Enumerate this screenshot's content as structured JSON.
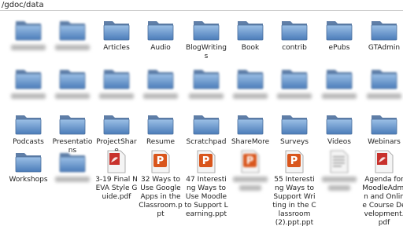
{
  "path": "/gdoc/data",
  "rows": [
    [
      {
        "label": "",
        "type": "folder",
        "blurred": true
      },
      {
        "label": "",
        "type": "folder",
        "blurred": true
      },
      {
        "label": "Articles",
        "type": "folder"
      },
      {
        "label": "Audio",
        "type": "folder"
      },
      {
        "label": "BlogWritings",
        "type": "folder"
      },
      {
        "label": "Book",
        "type": "folder"
      },
      {
        "label": "contrib",
        "type": "folder"
      },
      {
        "label": "ePubs",
        "type": "folder"
      },
      {
        "label": "GTAdmin",
        "type": "folder"
      }
    ],
    [
      {
        "label": "",
        "type": "folder",
        "blurred": true
      },
      {
        "label": "",
        "type": "folder",
        "blurred": true
      },
      {
        "label": "",
        "type": "folder",
        "blurred": true
      },
      {
        "label": "",
        "type": "folder",
        "blurred": true
      },
      {
        "label": "",
        "type": "folder",
        "blurred": true
      },
      {
        "label": "",
        "type": "folder",
        "blurred": true
      },
      {
        "label": "",
        "type": "folder",
        "blurred": true
      },
      {
        "label": "",
        "type": "folder",
        "blurred": true
      },
      {
        "label": "",
        "type": "folder",
        "blurred": true
      }
    ],
    [
      {
        "label": "Podcasts",
        "type": "folder"
      },
      {
        "label": "Presentations",
        "type": "folder"
      },
      {
        "label": "ProjectShare",
        "type": "folder"
      },
      {
        "label": "Resume",
        "type": "folder"
      },
      {
        "label": "Scratchpad",
        "type": "folder"
      },
      {
        "label": "ShareMore",
        "type": "folder"
      },
      {
        "label": "Surveys",
        "type": "folder"
      },
      {
        "label": "Videos",
        "type": "folder"
      },
      {
        "label": "Webinars",
        "type": "folder"
      }
    ],
    [
      {
        "label": "Workshops",
        "type": "folder"
      },
      {
        "label": "",
        "type": "folder",
        "blurred": true
      },
      {
        "label": "3-19 Final NEVA Style Guide.pdf",
        "type": "pdf"
      },
      {
        "label": "32 Ways to Use Google Apps in the Classroom.ppt",
        "type": "ppt"
      },
      {
        "label": "47 Interesting Ways to Use Moodle to Support Learning.ppt",
        "type": "ppt"
      },
      {
        "label": "",
        "type": "ppt",
        "blurred": true
      },
      {
        "label": "55 Interesting Ways to Support Writing in the Classroom (2).ppt.ppt",
        "type": "ppt"
      },
      {
        "label": "",
        "type": "doc",
        "blurred": true
      },
      {
        "label": "Agenda for MoodleAdmin and Online Course Development.pdf",
        "type": "pdf"
      }
    ]
  ],
  "colors": {
    "folder_dark": "#4b7cb9",
    "folder_light": "#9cc0e6",
    "pdf_red": "#c8312c",
    "ppt_orange": "#d9561d"
  }
}
